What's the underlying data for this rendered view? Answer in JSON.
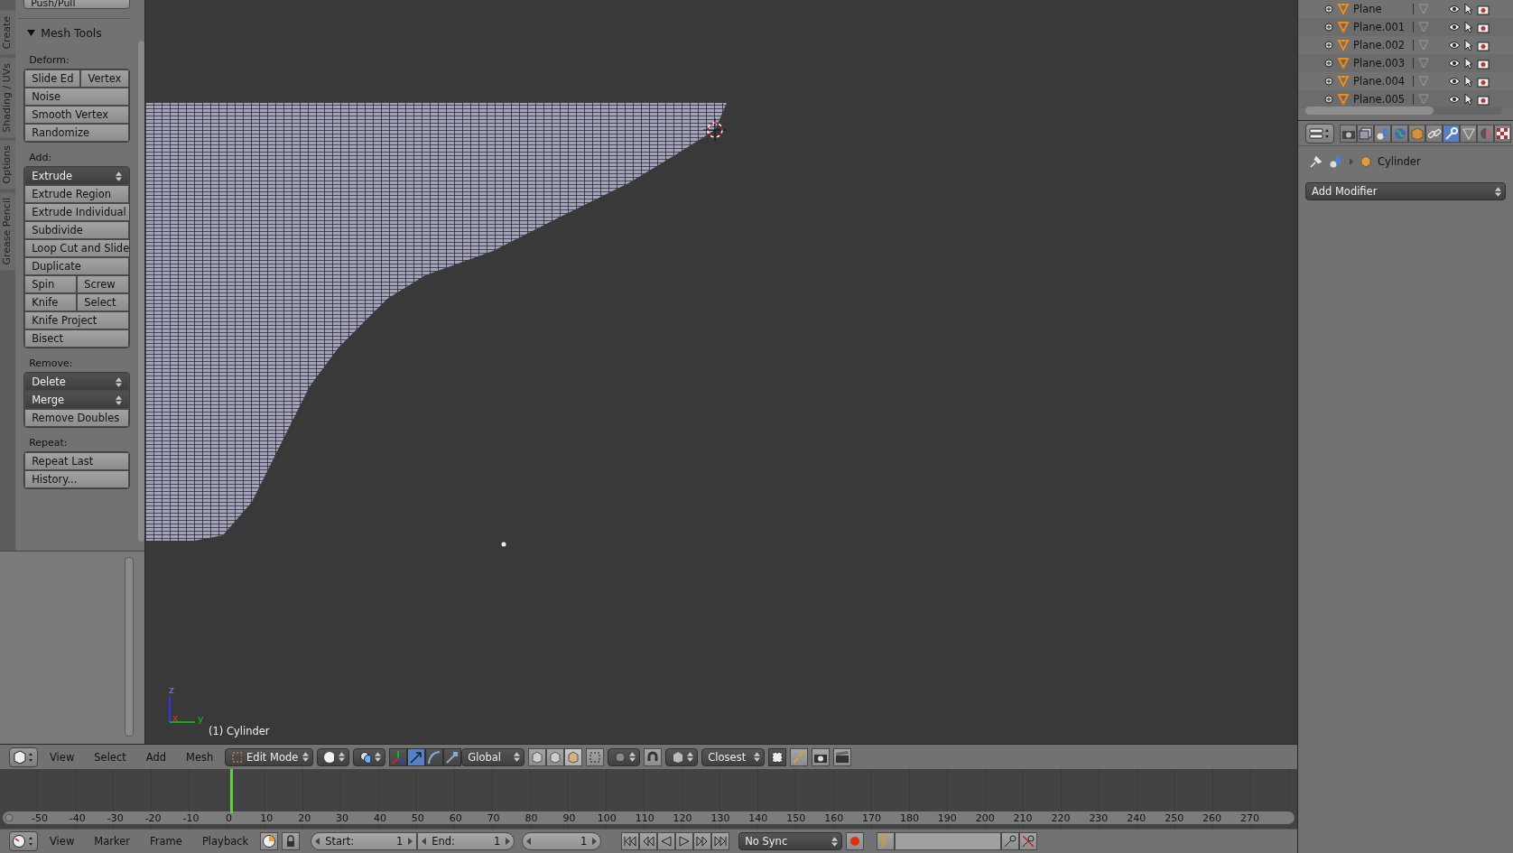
{
  "tool_shelf": {
    "tabs": [
      {
        "label": "Create",
        "selected": false
      },
      {
        "label": "Shading / UVs",
        "selected": false
      },
      {
        "label": "Options",
        "selected": false
      },
      {
        "label": "Grease Pencil",
        "selected": false
      }
    ],
    "partial_button": "Push/Pull",
    "panel": {
      "title": "Mesh Tools",
      "expanded": true,
      "groups": [
        {
          "label": "Deform:",
          "rows": [
            {
              "buttons": [
                {
                  "label": "Slide Ed",
                  "kind": "button"
                },
                {
                  "label": "Vertex",
                  "kind": "button"
                }
              ]
            },
            {
              "buttons": [
                {
                  "label": "Noise",
                  "kind": "button"
                }
              ]
            },
            {
              "buttons": [
                {
                  "label": "Smooth Vertex",
                  "kind": "button"
                }
              ]
            },
            {
              "buttons": [
                {
                  "label": "Randomize",
                  "kind": "button"
                }
              ]
            }
          ]
        },
        {
          "label": "Add:",
          "rows": [
            {
              "buttons": [
                {
                  "label": "Extrude",
                  "kind": "dropdown"
                }
              ]
            },
            {
              "buttons": [
                {
                  "label": "Extrude Region",
                  "kind": "button"
                }
              ]
            },
            {
              "buttons": [
                {
                  "label": "Extrude Individual",
                  "kind": "button"
                }
              ]
            },
            {
              "buttons": [
                {
                  "label": "Subdivide",
                  "kind": "button"
                }
              ]
            },
            {
              "buttons": [
                {
                  "label": "Loop Cut and Slide",
                  "kind": "button"
                }
              ]
            },
            {
              "buttons": [
                {
                  "label": "Duplicate",
                  "kind": "button"
                }
              ]
            },
            {
              "buttons": [
                {
                  "label": "Spin",
                  "kind": "button"
                },
                {
                  "label": "Screw",
                  "kind": "button"
                }
              ]
            },
            {
              "buttons": [
                {
                  "label": "Knife",
                  "kind": "button"
                },
                {
                  "label": "Select",
                  "kind": "button"
                }
              ]
            },
            {
              "buttons": [
                {
                  "label": "Knife Project",
                  "kind": "button"
                }
              ]
            },
            {
              "buttons": [
                {
                  "label": "Bisect",
                  "kind": "button"
                }
              ]
            }
          ]
        },
        {
          "label": "Remove:",
          "rows": [
            {
              "buttons": [
                {
                  "label": "Delete",
                  "kind": "dropdown"
                }
              ]
            },
            {
              "buttons": [
                {
                  "label": "Merge",
                  "kind": "dropdown"
                }
              ]
            },
            {
              "buttons": [
                {
                  "label": "Remove Doubles",
                  "kind": "button"
                }
              ]
            }
          ]
        },
        {
          "label": "Repeat:",
          "rows": [
            {
              "buttons": [
                {
                  "label": "Repeat Last",
                  "kind": "button"
                }
              ]
            },
            {
              "buttons": [
                {
                  "label": "History...",
                  "kind": "button"
                }
              ]
            }
          ]
        }
      ]
    }
  },
  "viewport": {
    "axes": {
      "z": "z",
      "x": "x",
      "y": "y"
    },
    "object_label": "(1) Cylinder"
  },
  "view3d_header": {
    "menus": [
      "View",
      "Select",
      "Add",
      "Mesh"
    ],
    "mode": "Edit Mode",
    "transform_manipulators": [
      {
        "kind": "translate",
        "selected": true
      },
      {
        "kind": "rotate",
        "selected": false
      },
      {
        "kind": "scale",
        "selected": false
      }
    ],
    "orientation": "Global",
    "select_modes": [
      {
        "kind": "vertex",
        "selected": false
      },
      {
        "kind": "edge",
        "selected": false
      },
      {
        "kind": "face",
        "selected": true
      }
    ],
    "snap_target": "Closest"
  },
  "timeline": {
    "ruler_labels": [
      "-50",
      "-40",
      "-30",
      "-20",
      "-10",
      "0",
      "10",
      "20",
      "30",
      "40",
      "50",
      "60",
      "70",
      "80",
      "90",
      "100",
      "110",
      "120",
      "130",
      "140",
      "150",
      "160",
      "170",
      "180",
      "190",
      "200",
      "210",
      "220",
      "230",
      "240",
      "250",
      "260",
      "270"
    ]
  },
  "timeline_header": {
    "menus": [
      "View",
      "Marker",
      "Frame",
      "Playback"
    ],
    "start_label": "Start:",
    "start": "1",
    "end_label": "End:",
    "end": "1",
    "current_frame": "1",
    "sync": "No Sync"
  },
  "outliner": {
    "items": [
      {
        "name": "Plane"
      },
      {
        "name": "Plane.001"
      },
      {
        "name": "Plane.002"
      },
      {
        "name": "Plane.003"
      },
      {
        "name": "Plane.004"
      },
      {
        "name": "Plane.005"
      }
    ]
  },
  "properties": {
    "tabs": [
      {
        "kind": "render",
        "selected": false
      },
      {
        "kind": "render-layers",
        "selected": false
      },
      {
        "kind": "scene",
        "selected": false
      },
      {
        "kind": "world",
        "selected": false
      },
      {
        "kind": "object",
        "selected": false
      },
      {
        "kind": "constraints",
        "selected": false
      },
      {
        "kind": "modifiers",
        "selected": true
      },
      {
        "kind": "data",
        "selected": false
      },
      {
        "kind": "material",
        "selected": false
      },
      {
        "kind": "texture",
        "selected": false
      }
    ],
    "breadcrumb": "Cylinder",
    "add_modifier": "Add Modifier"
  }
}
